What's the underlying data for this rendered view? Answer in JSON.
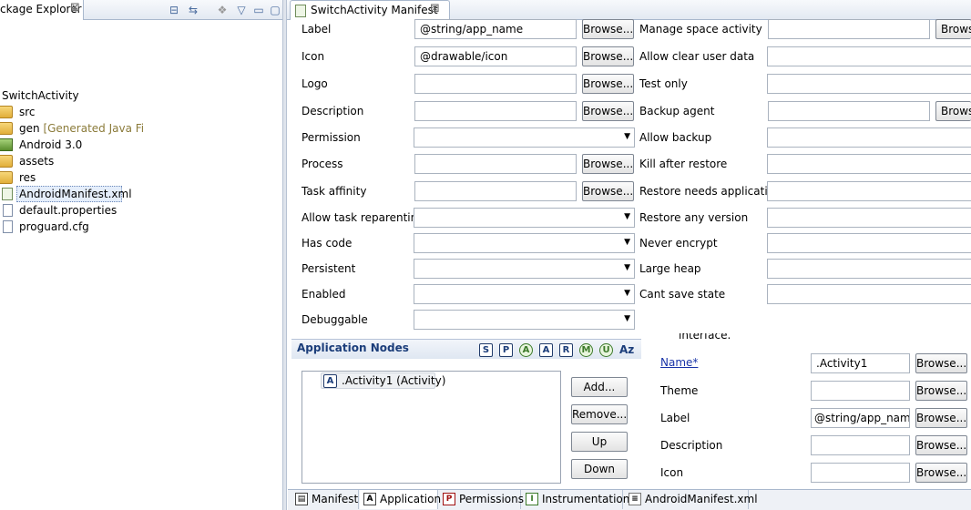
{
  "explorer": {
    "tab_title": "Package Explorer",
    "close_glyph": "⊠",
    "toolbar": [
      "collapse-all-icon",
      "link-with-editor-icon",
      "view-menu-icon",
      "minimize-icon",
      "maximize-icon"
    ],
    "tree": [
      {
        "label": "SwitchActivity",
        "icon": "project-icon"
      },
      {
        "label": "src",
        "icon": "folder-icon"
      },
      {
        "label": "gen",
        "suffix": "[Generated Java Files]",
        "icon": "folder-icon"
      },
      {
        "label": "Android 3.0",
        "icon": "library-icon"
      },
      {
        "label": "assets",
        "icon": "folder-icon"
      },
      {
        "label": "res",
        "icon": "folder-icon"
      },
      {
        "label": "AndroidManifest.xml",
        "icon": "xml-file-icon"
      },
      {
        "label": "default.properties",
        "icon": "file-icon"
      },
      {
        "label": "proguard.cfg",
        "icon": "file-icon"
      }
    ]
  },
  "editor": {
    "tab_title": "SwitchActivity Manifest",
    "close_glyph": "⊠"
  },
  "form_left": [
    {
      "label": "Label",
      "value": "@string/app_name",
      "button": "Browse..."
    },
    {
      "label": "Icon",
      "value": "@drawable/icon",
      "button": "Browse..."
    },
    {
      "label": "Logo",
      "value": "",
      "button": "Browse..."
    },
    {
      "label": "Description",
      "value": "",
      "button": "Browse..."
    },
    {
      "label": "Permission",
      "value": ""
    },
    {
      "label": "Process",
      "value": "",
      "button": "Browse..."
    },
    {
      "label": "Task affinity",
      "value": "",
      "button": "Browse..."
    },
    {
      "label": "Allow task reparenting",
      "value": ""
    },
    {
      "label": "Has code",
      "value": ""
    },
    {
      "label": "Persistent",
      "value": ""
    },
    {
      "label": "Enabled",
      "value": ""
    },
    {
      "label": "Debuggable",
      "value": ""
    }
  ],
  "form_right": [
    {
      "label": "Manage space activity",
      "value": "",
      "button": "Browse..."
    },
    {
      "label": "Allow clear user data",
      "value": ""
    },
    {
      "label": "Test only",
      "value": ""
    },
    {
      "label": "Backup agent",
      "value": "",
      "button": "Browse..."
    },
    {
      "label": "Allow backup",
      "value": ""
    },
    {
      "label": "Kill after restore",
      "value": ""
    },
    {
      "label": "Restore needs application",
      "value": ""
    },
    {
      "label": "Restore any version",
      "value": ""
    },
    {
      "label": "Never encrypt",
      "value": ""
    },
    {
      "label": "Large heap",
      "value": ""
    },
    {
      "label": "Cant save state",
      "value": ""
    }
  ],
  "nodes": {
    "title": "Application Nodes",
    "filters": [
      "S",
      "P",
      "A",
      "A",
      "R",
      "M",
      "U",
      "Az"
    ],
    "item_badge": "A",
    "item": ".Activity1 (Activity)",
    "buttons": [
      "Add...",
      "Remove...",
      "Up",
      "Down"
    ]
  },
  "details": {
    "interface_text": "interface.",
    "rows": [
      {
        "label": "Name*",
        "value": ".Activity1",
        "button": "Browse..."
      },
      {
        "label": "Theme",
        "value": "",
        "button": "Browse..."
      },
      {
        "label": "Label",
        "value": "@string/app_name",
        "button": "Browse..."
      },
      {
        "label": "Description",
        "value": "",
        "button": "Browse..."
      },
      {
        "label": "Icon",
        "value": "",
        "button": "Browse..."
      }
    ]
  },
  "bottom_tabs": [
    {
      "label": "Manifest",
      "badge": "▤"
    },
    {
      "label": "Application",
      "badge": "A"
    },
    {
      "label": "Permissions",
      "badge": "P"
    },
    {
      "label": "Instrumentation",
      "badge": "I"
    },
    {
      "label": "AndroidManifest.xml",
      "badge": "≡"
    }
  ]
}
